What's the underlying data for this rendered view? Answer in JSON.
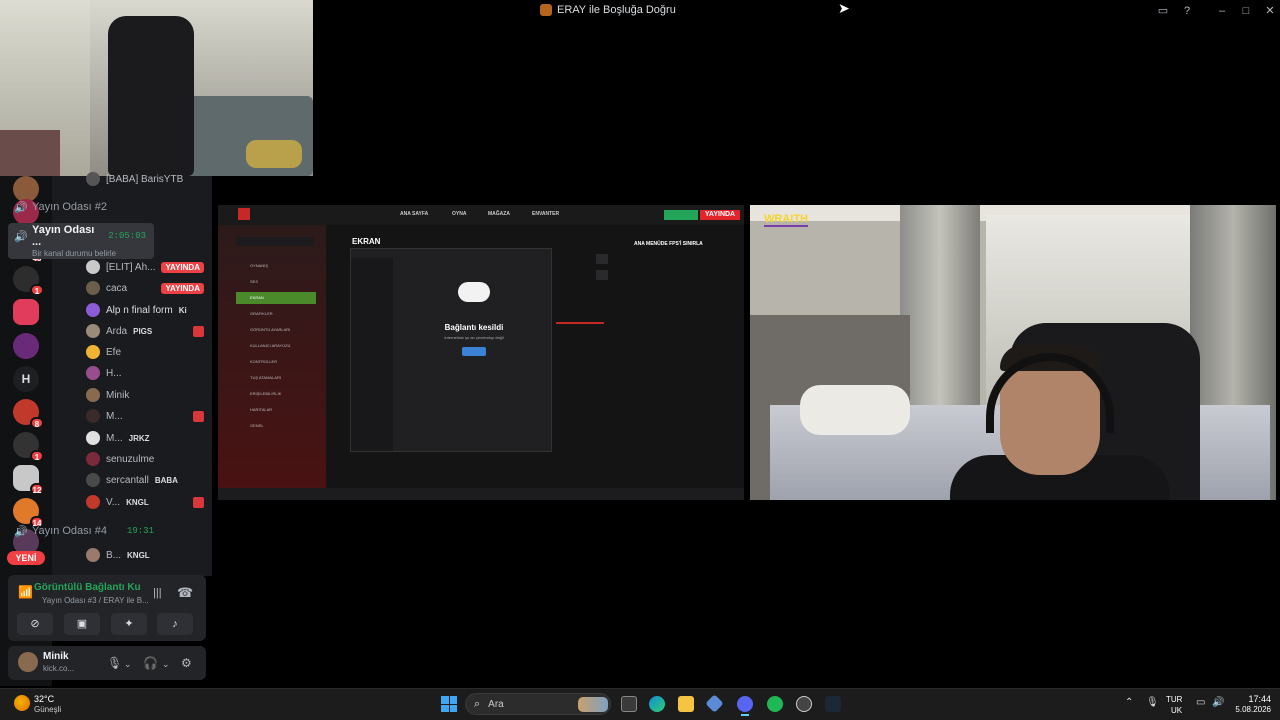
{
  "window": {
    "title": "ERAY ile Boşluğa Doğru"
  },
  "sidebar": {
    "partial_user": "[BABA] BarisYTB",
    "channel_2": "Yayın Odası #2",
    "active_channel": {
      "name": "Yayın Odası ...",
      "timer": "2:05:03",
      "status": "Bir kanal durumu belirle"
    },
    "users": [
      {
        "name": "[ELIT] Ah...",
        "badge": "YAYINDA",
        "color": "#c9c9c9"
      },
      {
        "name": "caca",
        "badge": "YAYINDA",
        "color": "#6b5e4a"
      },
      {
        "name": "Alp n final form",
        "tag": "Ki",
        "color": "#8c5bd6"
      },
      {
        "name": "Arda",
        "tag": "PIGS",
        "color": "#9a8a7a",
        "muted": true
      },
      {
        "name": "Efe",
        "color": "#f0b232"
      },
      {
        "name": "H...",
        "color": "#9a4d8c"
      },
      {
        "name": "Minik",
        "color": "#8a6a4e"
      },
      {
        "name": "M...",
        "color": "#3a2a2a",
        "muted": true
      },
      {
        "name": "M...",
        "tag": "JRKZ",
        "color": "#e0e0e0"
      },
      {
        "name": "senuzulme",
        "color": "#7a2a3a"
      },
      {
        "name": "sercantall",
        "tag": "BABA",
        "color": "#4a4a4a"
      },
      {
        "name": "V...",
        "tag": "KNGL",
        "color": "#c0392b",
        "muted": true
      }
    ],
    "channel_4": {
      "name": "Yayın Odası #4",
      "timer": "19:31"
    },
    "channel_4_user": {
      "name": "B...",
      "tag": "KNGL"
    },
    "new_badge": "YENİ",
    "server_badges": [
      "46",
      "1",
      "8",
      "1",
      "12",
      "14"
    ]
  },
  "voice": {
    "title": "Görüntülü Bağlantı Ku",
    "subtitle": "Yayın Odası #3 / ERAY ile B..."
  },
  "me": {
    "name": "Minik",
    "status": "kick.co..."
  },
  "stream": {
    "nav": [
      "ANA SAYFA",
      "OYNA",
      "MAĞAZA",
      "ENVANTER"
    ],
    "live_badge": "YAYINDA",
    "menu": [
      "OYNANIŞ",
      "SES",
      "EKRAN",
      "GRAFİKLER",
      "GÖRÜNTÜ AYARLARI",
      "KULLANICI ARAYÜZÜ",
      "KONTROLLER",
      "TUŞ ATAMALARI",
      "ERİŞİLEBİLİRLİK",
      "HARİTALAR",
      "GENEL"
    ],
    "selected_menu": "EKRAN",
    "section_title": "EKRAN",
    "right_title": "ANA MENÜDE FPS'İ SINIRLA",
    "modal_title": "Bağlantı kesildi",
    "modal_sub": "İnternetiniz şu an çevrimdışı değil"
  },
  "webcam": {
    "overlay_label": "WRAITH"
  },
  "taskbar": {
    "weather_temp": "32°C",
    "weather_desc": "Güneşli",
    "search_label": "Ara",
    "lang_1": "TUR",
    "lang_2": "UK",
    "time": "17:44",
    "date": "5.08.2026"
  }
}
